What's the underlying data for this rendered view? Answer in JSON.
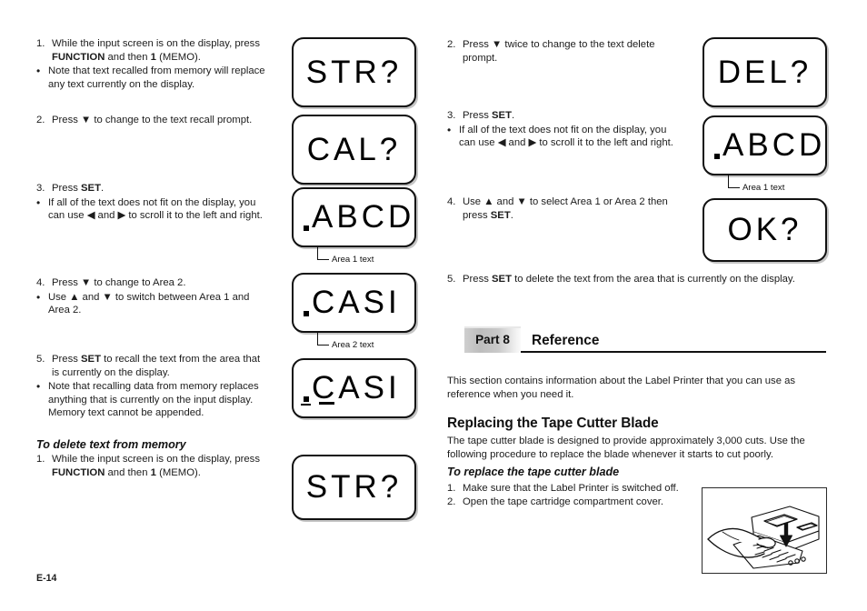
{
  "page": {
    "folio": "E-14"
  },
  "left_column": {
    "recall_steps": [
      {
        "num": "1.",
        "text_parts": [
          "While the input screen is on the display, press ",
          "FUNCTION",
          " and then ",
          "1",
          " (MEMO)."
        ]
      },
      {
        "num": "2.",
        "text": "Press ▼ to change to the text recall prompt."
      },
      {
        "num": "3.",
        "text": "Press SET."
      },
      {
        "num": "4.",
        "text": "Press ▼ to change to Area 2."
      },
      {
        "num": "5.",
        "text": "Press SET to recall the text from the area that is currently on the display."
      }
    ],
    "step1_line1": "While the input screen is on the display, press",
    "step1_bold_a": "FUNCTION",
    "step1_mid": " and then ",
    "step1_bold_b": "1",
    "step1_end": " (MEMO).",
    "note1_line1": "Note that text recalled from memory will replace",
    "note1_line2": "any text currently on the display.",
    "step2_text": "Press ▼ to change to the text recall prompt.",
    "step3_pre": "Press ",
    "step3_bold": "SET",
    "step3_post": ".",
    "note3_line1": "If all of the text does not fit on the display, you",
    "note3_line2": "can use ◀ and ▶ to scroll it to the left and right.",
    "step4_text": "Press ▼ to change to Area 2.",
    "note4_line1": "Use ▲ and ▼ to switch between Area 1 and",
    "note4_line2": "Area 2.",
    "step5_pre": "Press ",
    "step5_bold": "SET",
    "step5_post": " to recall the text from the area that",
    "step5_line2": "is currently on the display.",
    "note5_line1": "Note that recalling data from memory replaces",
    "note5_line2": "anything that is currently on the input display.",
    "note5_line3": "Memory text cannot be appended.",
    "delete_heading": "To delete text from memory",
    "delete_step1_line1": "While the input screen is on the display, press",
    "delete_step1_bold_a": "FUNCTION",
    "delete_step1_mid": " and then ",
    "delete_step1_bold_b": "1",
    "delete_step1_end": " (MEMO).",
    "bullet_glyph": "•",
    "numbers": {
      "one": "1.",
      "two": "2.",
      "three": "3.",
      "four": "4.",
      "five": "5."
    }
  },
  "right_column": {
    "step2_line1": "Press ▼ twice to change to the text delete",
    "step2_line2": "prompt.",
    "step3_pre": "Press ",
    "step3_bold": "SET",
    "step3_post": ".",
    "note3_line1": "If all of the text does not fit on the display, you",
    "note3_line2": "can use ◀ and ▶ to scroll it to the left and right.",
    "step4_line1": "Use ▲ and ▼ to select Area 1 or Area 2 then",
    "step4_line2_pre": "press ",
    "step4_line2_bold": "SET",
    "step4_line2_post": ".",
    "step5_pre": "Press ",
    "step5_bold": "SET",
    "step5_post": " to delete the text from the area that is currently on the display.",
    "numbers": {
      "two": "2.",
      "three": "3.",
      "four": "4.",
      "five": "5."
    },
    "bullet_glyph": "•",
    "part_tag": "Part 8",
    "part_title": "Reference",
    "intro_line1": "This section contains information about the Label Printer that you can use as",
    "intro_line2": "reference when you need it.",
    "cutter_heading": "Replacing the Tape Cutter Blade",
    "cutter_body_line1": "The tape cutter blade is designed to provide approximately 3,000 cuts.  Use the",
    "cutter_body_line2": "following procedure to replace the blade whenever it starts to cut poorly.",
    "replace_heading": "To replace the tape cutter blade",
    "replace_step1_num": "1.",
    "replace_step1_text": "Make sure that the Label Printer is switched off.",
    "replace_step2_num": "2.",
    "replace_step2_text": "Open the tape  cartridge compartment cover."
  },
  "lcd_displays": [
    {
      "id": "left-1",
      "text": "STR?",
      "cursor": false,
      "underline": false,
      "callout": null
    },
    {
      "id": "left-2",
      "text": "CAL?",
      "cursor": false,
      "underline": false,
      "callout": null
    },
    {
      "id": "left-3",
      "text": "ABCD",
      "cursor": true,
      "underline": false,
      "callout": "Area 1 text"
    },
    {
      "id": "left-4",
      "text": "CASI",
      "cursor": true,
      "underline": false,
      "callout": "Area 2 text"
    },
    {
      "id": "left-5",
      "text": "CASI",
      "cursor": true,
      "underline": true,
      "callout": null
    },
    {
      "id": "left-6",
      "text": "STR?",
      "cursor": false,
      "underline": false,
      "callout": null
    },
    {
      "id": "right-1",
      "text": "DEL?",
      "cursor": false,
      "underline": false,
      "callout": null
    },
    {
      "id": "right-2",
      "text": "ABCD",
      "cursor": true,
      "underline": false,
      "callout": "Area 1 text"
    },
    {
      "id": "right-3",
      "text": "OK?",
      "cursor": false,
      "underline": false,
      "callout": null
    }
  ],
  "callouts": {
    "area1_left": "Area 1 text",
    "area2_left": "Area 2 text",
    "area1_right": "Area 1 text"
  },
  "illustration": {
    "name": "label-printer-open-cover-illustration",
    "description": "Line drawing of a hand pressing down on the tape cartridge compartment cover of the Label Printer, with a downward arrow."
  }
}
